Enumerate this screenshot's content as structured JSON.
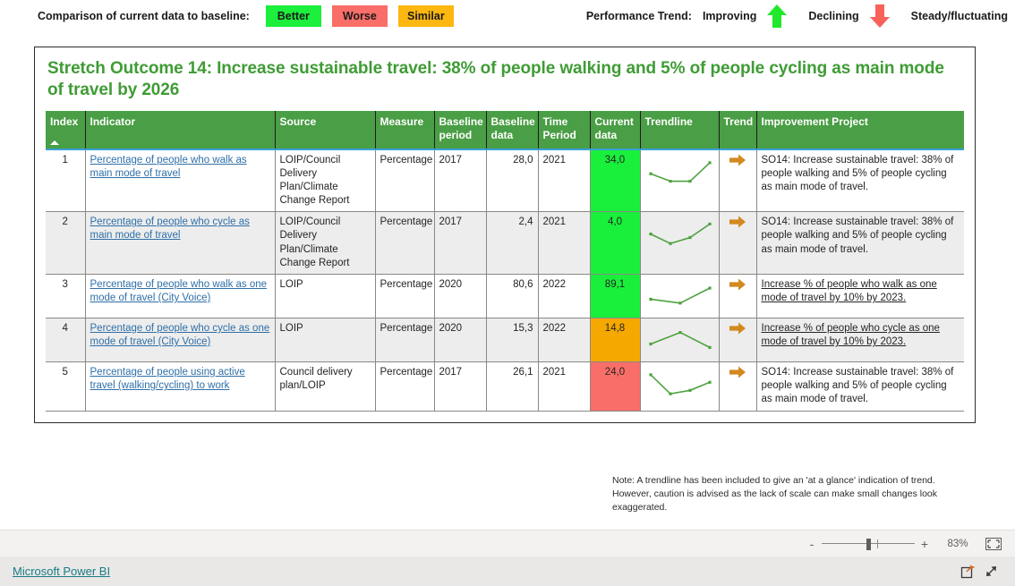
{
  "legend": {
    "baseline_label": "Comparison of current data to baseline:",
    "chips": [
      {
        "label": "Better",
        "color": "#1cf03c"
      },
      {
        "label": "Worse",
        "color": "#f96e68"
      },
      {
        "label": "Similar",
        "color": "#fcb711"
      }
    ],
    "trend_label": "Performance Trend:",
    "trends": [
      {
        "label": "Improving",
        "icon": "arrow-up-icon",
        "color": "#22e82c"
      },
      {
        "label": "Declining",
        "icon": "arrow-down-icon",
        "color": "#f9615b"
      },
      {
        "label": "Steady/fluctuating",
        "icon": "arrow-right-icon",
        "color": "#fcb711"
      }
    ]
  },
  "card": {
    "title": "Stretch Outcome 14: Increase sustainable travel: 38% of people walking and 5% of people cycling as main mode of travel by 2026",
    "title_color": "#3f9c35",
    "header_color": "#4a9e45"
  },
  "table": {
    "columns": [
      "Index",
      "Indicator",
      "Source",
      "Measure",
      "Baseline period",
      "Baseline data",
      "Time Period",
      "Current data",
      "Trendline",
      "Trend",
      "Improvement Project"
    ],
    "sort_column": "Index",
    "sort_direction": "ascending",
    "rows": [
      {
        "index": "1",
        "indicator": "Percentage of people who walk as main mode of travel",
        "indicator_is_link": true,
        "source": "LOIP/Council Delivery Plan/Climate Change Report",
        "measure": "Percentage",
        "baseline_period": "2017",
        "baseline_data": "28,0",
        "time_period": "2021",
        "current_data": "34,0",
        "current_status": "better",
        "trend": "steady",
        "trend_icon": "arrow-right-icon",
        "sparkline": [
          58,
          88,
          88,
          14
        ],
        "project": "SO14: Increase sustainable travel: 38% of people walking and 5% of people cycling as main mode of travel.",
        "project_is_link": false
      },
      {
        "index": "2",
        "indicator": "Percentage of people who cycle as main mode of travel",
        "indicator_is_link": true,
        "source": "LOIP/Council Delivery Plan/Climate Change Report",
        "measure": "Percentage",
        "baseline_period": "2017",
        "baseline_data": "2,4",
        "time_period": "2021",
        "current_data": "4,0",
        "current_status": "better",
        "trend": "steady",
        "trend_icon": "arrow-right-icon",
        "sparkline": [
          52,
          90,
          66,
          12
        ],
        "project": "SO14: Increase sustainable travel: 38% of people walking and 5% of people cycling as main mode of travel.",
        "project_is_link": false
      },
      {
        "index": "3",
        "indicator": "Percentage of people who walk as one mode of travel (City Voice)",
        "indicator_is_link": true,
        "source": "LOIP",
        "measure": "Percentage",
        "baseline_period": "2020",
        "baseline_data": "80,6",
        "time_period": "2022",
        "current_data": "89,1",
        "current_status": "better",
        "trend": "steady",
        "trend_icon": "arrow-right-icon",
        "sparkline": [
          62,
          78,
          18
        ],
        "project": "Increase % of people who walk as one mode of travel by 10% by 2023.",
        "project_is_link": true
      },
      {
        "index": "4",
        "indicator": "Percentage of people who cycle as one mode of travel (City Voice)",
        "indicator_is_link": true,
        "source": "LOIP",
        "measure": "Percentage",
        "baseline_period": "2020",
        "baseline_data": "15,3",
        "time_period": "2022",
        "current_data": "14,8",
        "current_status": "similar",
        "trend": "steady",
        "trend_icon": "arrow-right-icon",
        "sparkline": [
          66,
          20,
          80
        ],
        "project": "Increase % of people who cycle as one mode of travel by 10% by 2023.",
        "project_is_link": true
      },
      {
        "index": "5",
        "indicator": "Percentage of people using active travel (walking/cycling) to work",
        "indicator_is_link": true,
        "source": "Council delivery plan/LOIP",
        "measure": "Percentage",
        "baseline_period": "2017",
        "baseline_data": "26,1",
        "time_period": "2021",
        "current_data": "24,0",
        "current_status": "worse",
        "trend": "steady",
        "trend_icon": "arrow-right-icon",
        "sparkline": [
          14,
          90,
          76,
          44
        ],
        "project": "SO14: Increase sustainable travel: 38% of people walking and 5% of people cycling as main mode of travel.",
        "project_is_link": false
      }
    ]
  },
  "note": "Note: A trendline has been included to give an 'at a glance' indication of trend.  However, caution is advised as the lack of scale can make small changes look exaggerated.",
  "zoombar": {
    "minus": "-",
    "plus": "+",
    "zoom_level": "83%",
    "fit_icon": "fit-to-page-icon"
  },
  "footer": {
    "brand": "Microsoft Power BI",
    "brand_color": "#1b7b85",
    "share_icon": "share-icon",
    "fullscreen_icon": "fullscreen-icon"
  }
}
